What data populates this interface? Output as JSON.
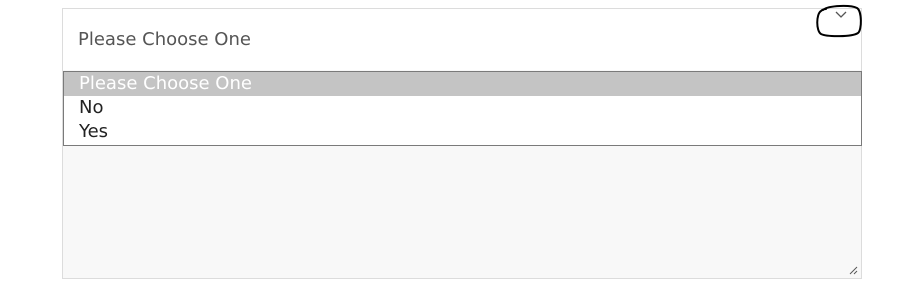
{
  "select": {
    "value": "Please Choose One",
    "chevron_icon": "chevron-down-icon",
    "options": [
      {
        "label": "Please Choose One",
        "selected": true
      },
      {
        "label": "No",
        "selected": false
      },
      {
        "label": "Yes",
        "selected": false
      }
    ]
  },
  "colors": {
    "selected_option_bg": "#c4c4c4",
    "selected_option_text": "#ffffff",
    "field_text": "#555555",
    "textarea_bg": "#f8f8f8"
  }
}
